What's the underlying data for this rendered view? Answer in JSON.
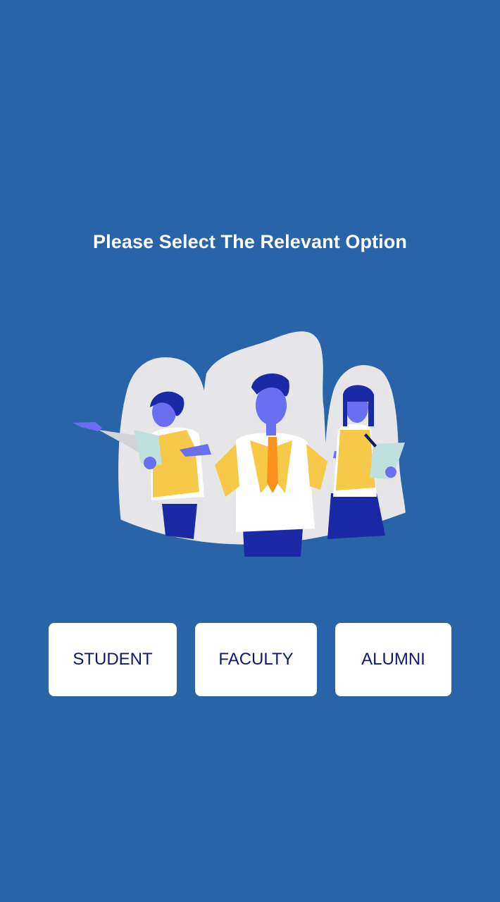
{
  "header": {
    "title": "Please Select The Relevant Option"
  },
  "illustration": {
    "icon": "people-group-illustration"
  },
  "options": {
    "student_label": "STUDENT",
    "faculty_label": "FACULTY",
    "alumni_label": "ALUMNI"
  },
  "colors": {
    "background": "#2a64a8",
    "button_bg": "#ffffff",
    "button_text": "#0d1a6e",
    "accent_yellow": "#f7c948",
    "skin_purple": "#6a6ff2",
    "navy": "#1a2aa6"
  }
}
